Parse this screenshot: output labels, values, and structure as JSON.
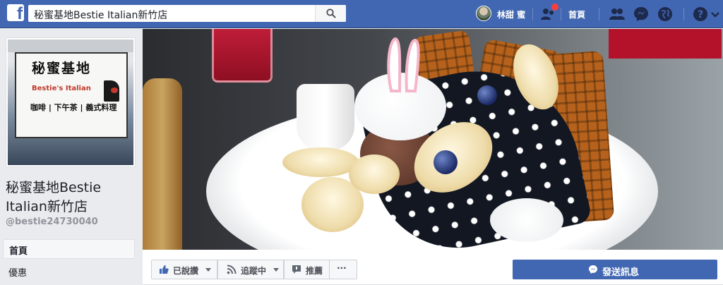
{
  "topbar": {
    "logo": "f",
    "search_value": "秘蜜基地Bestie Italian新竹店",
    "user_name": "林甜 蜜",
    "home_label": "首頁",
    "icons": [
      "search-icon",
      "friend-requests-icon",
      "friends-icon",
      "messenger-icon",
      "globe-icon",
      "help-icon",
      "caret-down-icon"
    ],
    "accent_color": "#4267b2",
    "notification_color": "#fa3e3e"
  },
  "sidebar": {
    "sign_title": "秘蜜基地",
    "sign_subtitle": "Bestie's Italian",
    "sign_row": "咖啡 | 下午茶 | 義式料理",
    "page_name": "秘蜜基地Bestie Italian新竹店",
    "handle": "@bestie24730040",
    "items": [
      {
        "label": "首頁",
        "active": true
      },
      {
        "label": "優惠",
        "active": false
      }
    ]
  },
  "actions": {
    "liked_label": "已說讚",
    "following_label": "追蹤中",
    "recommend_label": "推薦",
    "more_label": "···",
    "message_label": "發送訊息"
  }
}
